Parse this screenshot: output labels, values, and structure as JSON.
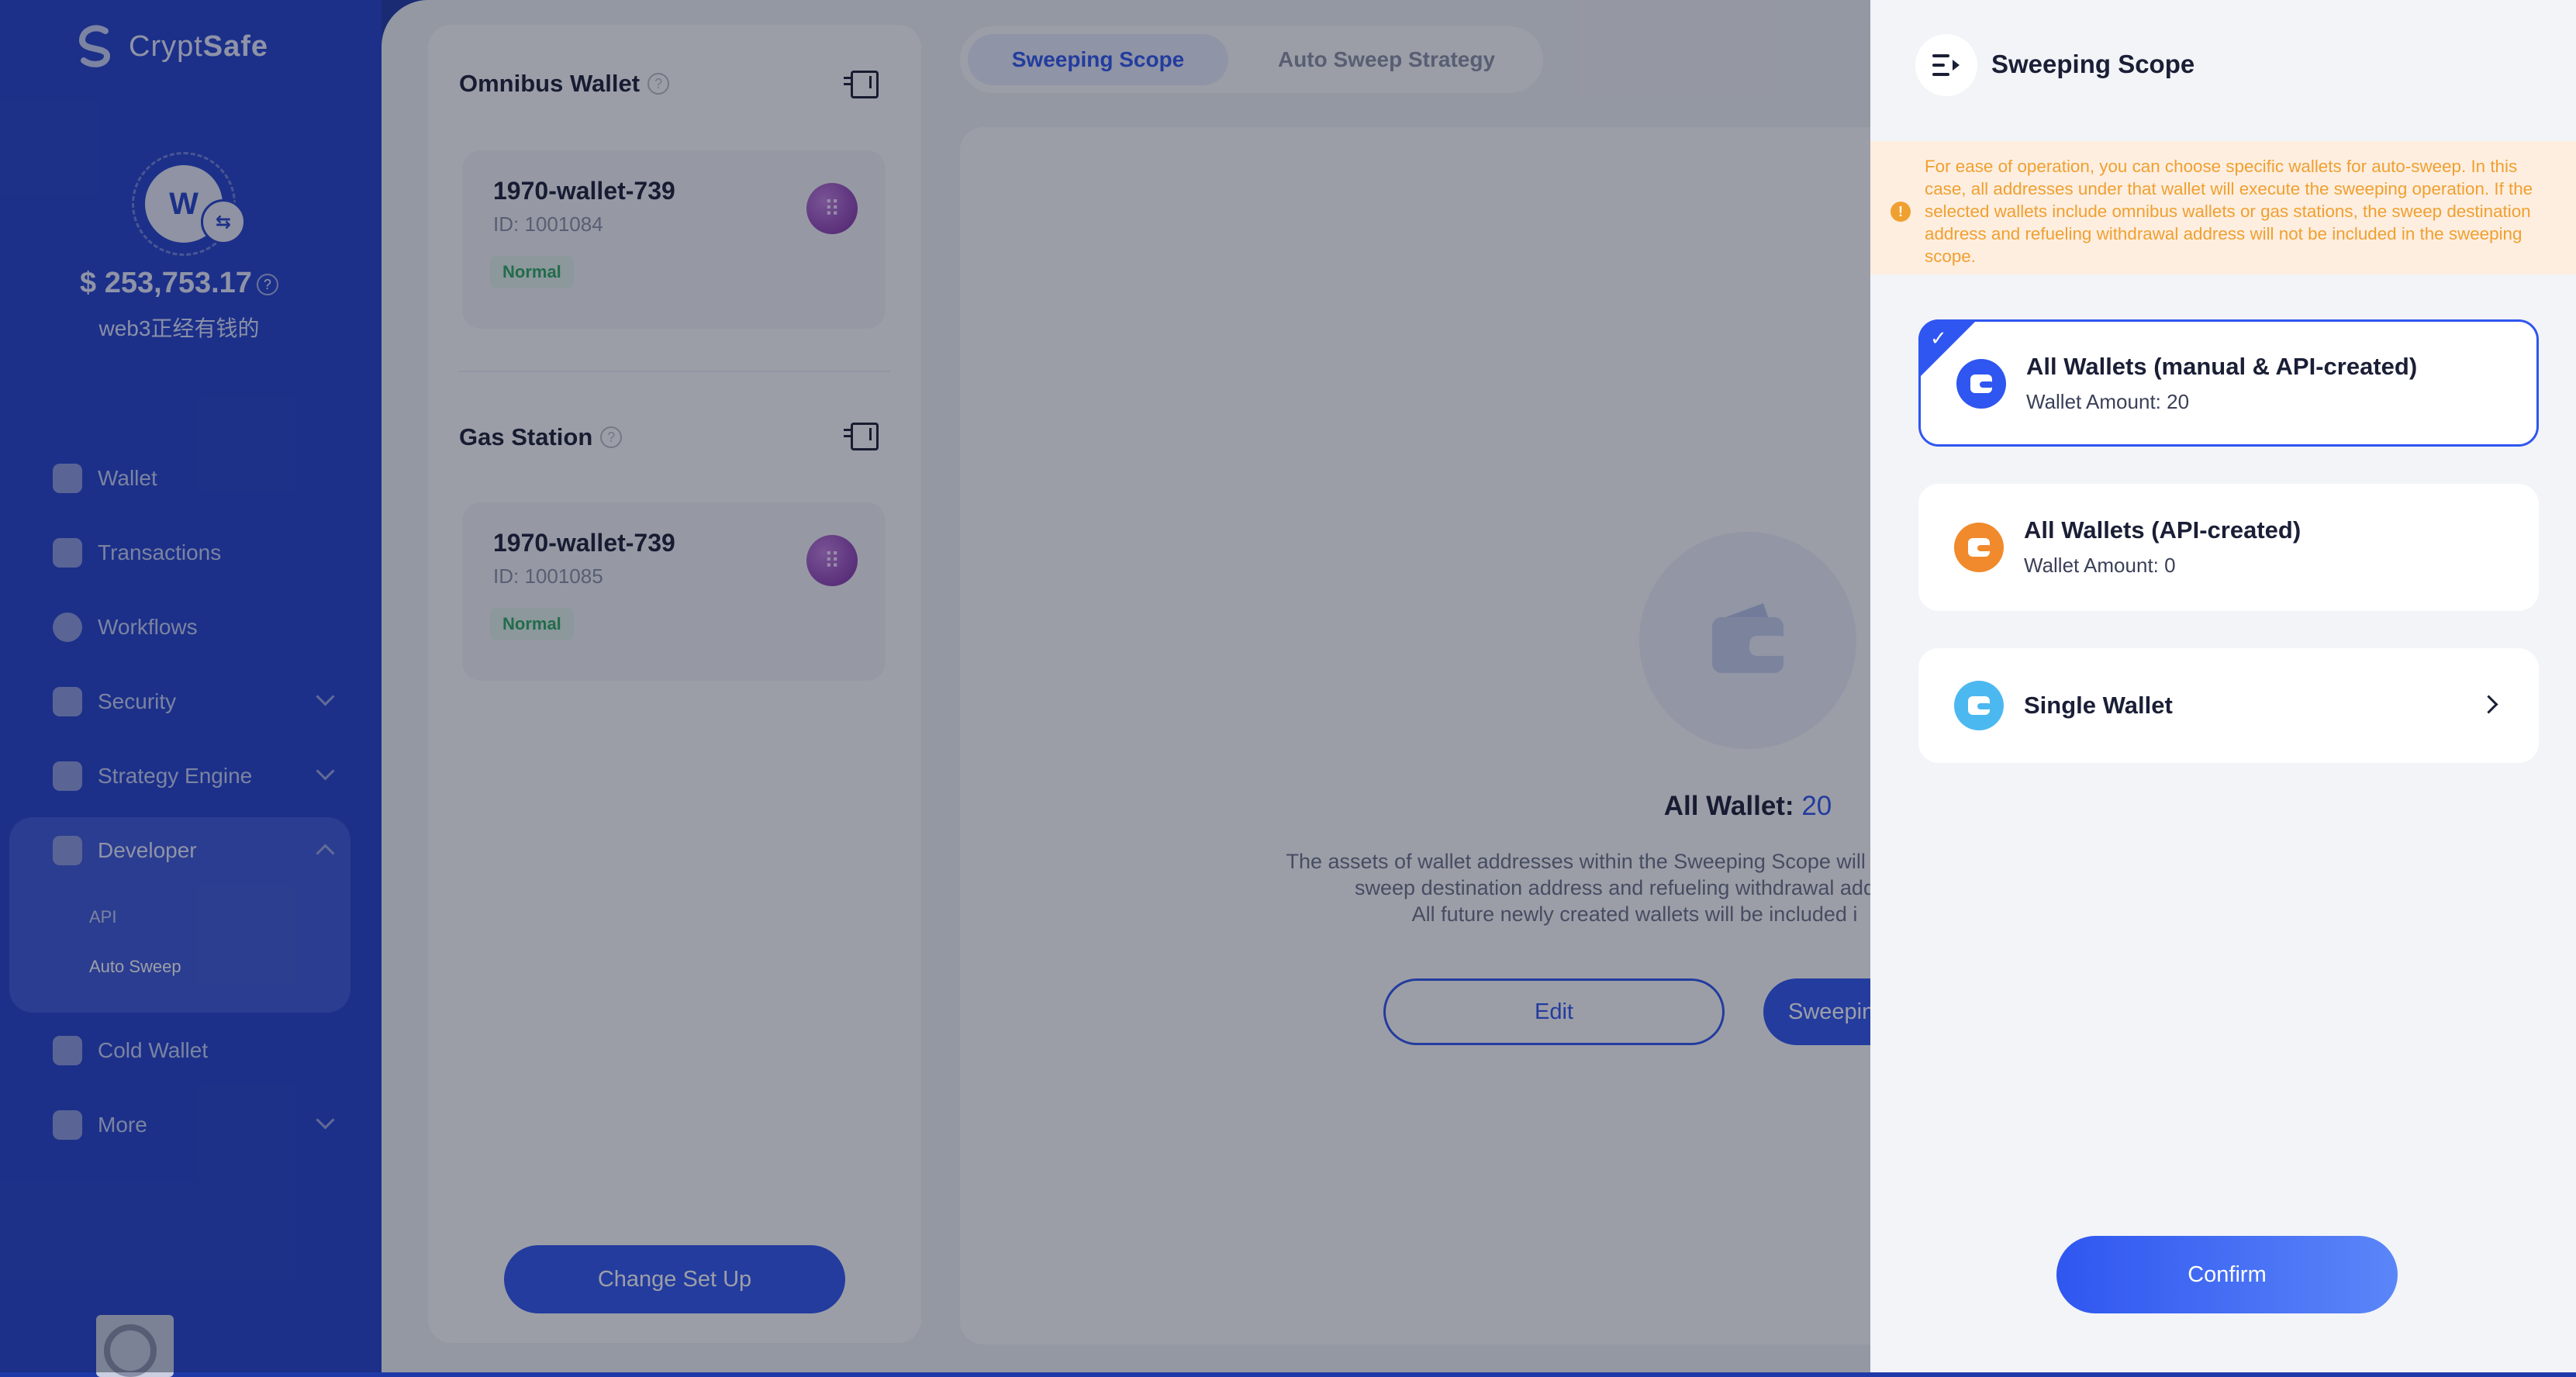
{
  "brand": {
    "name_part1": "Crypt",
    "name_part2": "Safe"
  },
  "account": {
    "avatar_letter": "W",
    "balance": "$ 253,753.17",
    "name": "web3正经有钱的"
  },
  "sidebar": {
    "items": [
      {
        "label": "Wallet"
      },
      {
        "label": "Transactions"
      },
      {
        "label": "Workflows"
      },
      {
        "label": "Security"
      },
      {
        "label": "Strategy Engine"
      },
      {
        "label": "Developer"
      },
      {
        "label": "Cold Wallet"
      },
      {
        "label": "More"
      }
    ],
    "developer_sub": [
      {
        "label": "API"
      },
      {
        "label": "Auto Sweep"
      }
    ]
  },
  "left_panel": {
    "omnibus": {
      "title": "Omnibus Wallet",
      "wallet_name": "1970-wallet-739",
      "wallet_id": "ID: 1001084",
      "status": "Normal"
    },
    "gas": {
      "title": "Gas Station",
      "wallet_name": "1970-wallet-739",
      "wallet_id": "ID: 1001085",
      "status": "Normal"
    },
    "change_button": "Change Set Up"
  },
  "tabs": [
    {
      "label": "Sweeping Scope"
    },
    {
      "label": "Auto Sweep Strategy"
    }
  ],
  "main": {
    "all_wallet_label": "All Wallet:",
    "all_wallet_count": "20",
    "desc_line1": "The assets of wallet addresses within the Sweeping Scope will be swept ac",
    "desc_line2": "sweep destination address and refueling withdrawal address",
    "desc_line3": "All future newly created wallets will be included i",
    "edit_button": "Edit",
    "sweep_button": "Sweepin"
  },
  "drawer": {
    "title": "Sweeping Scope",
    "notice": "For ease of operation, you can choose specific wallets for auto-sweep. In this case, all addresses under that wallet will execute the sweeping operation. If the selected wallets include omnibus wallets or gas stations, the sweep destination address and refueling withdrawal address will not be included in the sweeping scope.",
    "options": [
      {
        "title": "All Wallets (manual & API-created)",
        "subtitle": "Wallet Amount: 20",
        "color": "#2f56f0"
      },
      {
        "title": "All Wallets (API-created)",
        "subtitle": "Wallet Amount: 0",
        "color": "#f08a2c"
      },
      {
        "title": "Single Wallet",
        "subtitle": "",
        "color": "#4cb8f0"
      }
    ],
    "confirm_button": "Confirm"
  },
  "colors": {
    "primary": "#2f56f0",
    "sidebar": "#2443cc",
    "warning": "#f0a030",
    "success": "#2eaa63"
  }
}
